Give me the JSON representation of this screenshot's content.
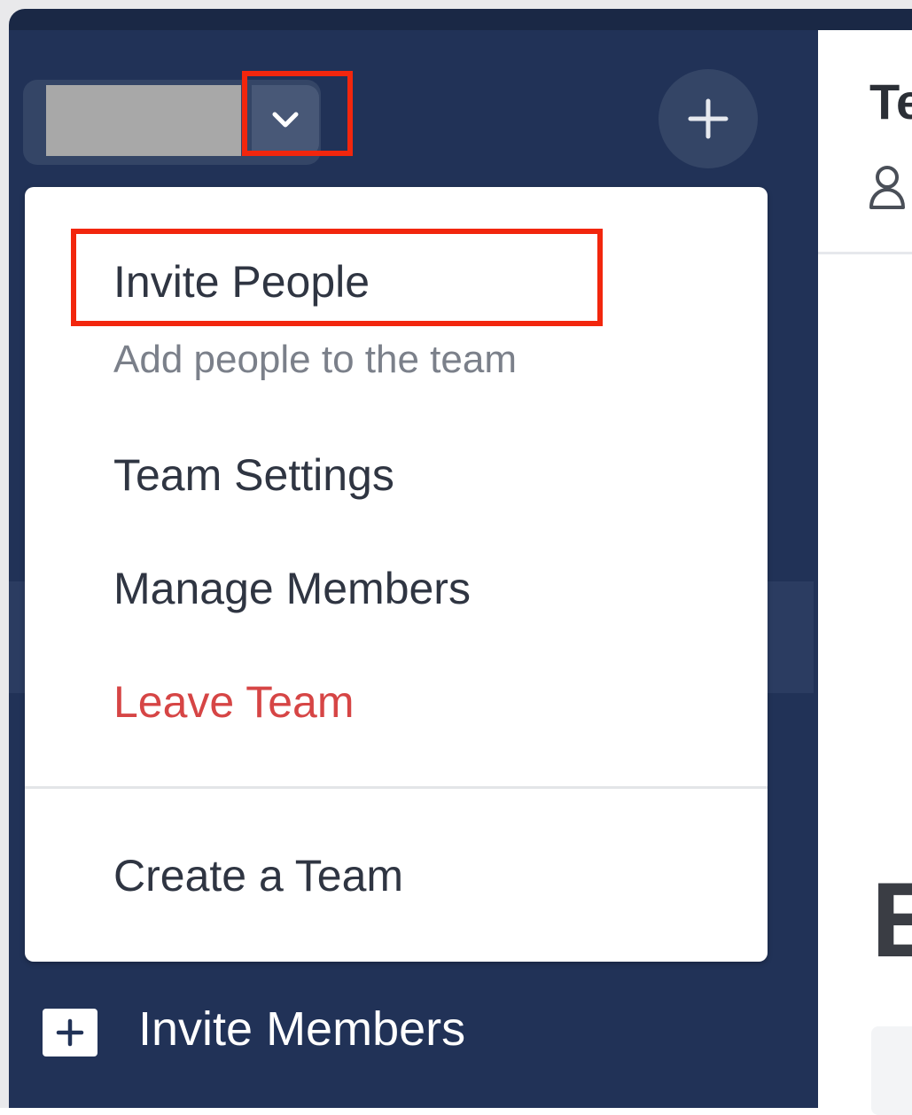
{
  "sidebar": {
    "team_name": "",
    "invite_members_label": "Invite Members"
  },
  "dropdown": {
    "invite_people_label": "Invite People",
    "invite_people_description": "Add people to the team",
    "team_settings_label": "Team Settings",
    "manage_members_label": "Manage Members",
    "leave_team_label": "Leave Team",
    "create_team_label": "Create a Team"
  },
  "main": {
    "title_partial": "Te",
    "heading_partial": "E"
  },
  "icons": {
    "team_menu": "chevron-down-icon",
    "add": "plus-icon",
    "member": "person-icon"
  },
  "colors": {
    "sidebar": "#213257",
    "danger": "#d64545",
    "highlight": "#f2260d"
  }
}
